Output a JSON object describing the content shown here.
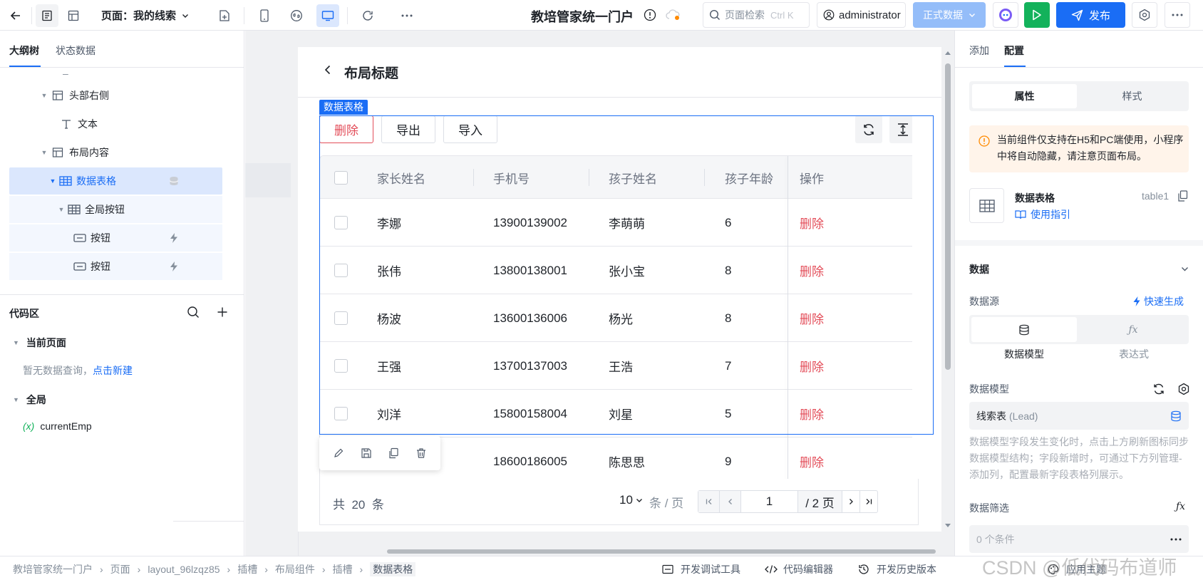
{
  "topbar": {
    "page_label": "页面：我的线索",
    "app_title": "教培管家统一门户",
    "search_placeholder": "页面检索",
    "search_shortcut": "Ctrl K",
    "user": "administrator",
    "env": "正式数据",
    "publish": "发布"
  },
  "left": {
    "tabs": [
      "大纲树",
      "状态数据"
    ],
    "tree": {
      "dash": "–",
      "header_right": "头部右侧",
      "text": "文本",
      "layout_content": "布局内容",
      "data_table": "数据表格",
      "global_buttons": "全局按钮",
      "button1": "按钮",
      "button2": "按钮"
    },
    "code": {
      "title": "代码区",
      "current_page": "当前页面",
      "empty_hint": "暂无数据查询，",
      "create_link": "点击新建",
      "global": "全局",
      "var_icon": "(x)",
      "var_name": "currentEmp"
    }
  },
  "canvas": {
    "page_title": "布局标题",
    "selected_tag": "数据表格",
    "buttons": [
      "删除",
      "导出",
      "导入"
    ],
    "columns": [
      "家长姓名",
      "手机号",
      "孩子姓名",
      "孩子年龄",
      "操作"
    ],
    "rows": [
      {
        "parent": "李娜",
        "phone": "13900139002",
        "child": "李萌萌",
        "age": "6",
        "action": "删除"
      },
      {
        "parent": "张伟",
        "phone": "13800138001",
        "child": "张小宝",
        "age": "8",
        "action": "删除"
      },
      {
        "parent": "杨波",
        "phone": "13600136006",
        "child": "杨光",
        "age": "8",
        "action": "删除"
      },
      {
        "parent": "王强",
        "phone": "13700137003",
        "child": "王浩",
        "age": "7",
        "action": "删除"
      },
      {
        "parent": "刘洋",
        "phone": "15800158004",
        "child": "刘星",
        "age": "5",
        "action": "删除"
      },
      {
        "parent": "",
        "phone": "18600186005",
        "child": "陈思思",
        "age": "9",
        "action": "删除"
      }
    ],
    "pagination": {
      "total_prefix": "共",
      "total": "20",
      "total_suffix": "条",
      "page_size": "10",
      "per_page": "条 / 页",
      "current": "1",
      "pages": "/ 2 页"
    }
  },
  "right": {
    "tabs": [
      "添加",
      "配置"
    ],
    "subtabs": [
      "属性",
      "样式"
    ],
    "warning": "当前组件仅支持在H5和PC端使用，小程序中将自动隐藏，请注意页面布局。",
    "component_name": "数据表格",
    "component_id": "table1",
    "guide_link": "使用指引",
    "section_data": "数据",
    "datasource_label": "数据源",
    "quick_gen": "快速生成",
    "ds_options": [
      "数据模型",
      "表达式"
    ],
    "model_label": "数据模型",
    "model_value": "线索表",
    "model_value_en": "(Lead)",
    "model_hint": "数据模型字段发生变化时，点击上方刷新图标同步数据模型结构；字段新增时，可通过下方列管理-添加列，配置最新字段表格列展示。",
    "filter_label": "数据筛选",
    "filter_value": "0 个条件"
  },
  "status": {
    "breadcrumb": [
      "教培管家统一门户",
      "页面",
      "layout_96lzqz85",
      "插槽",
      "布局组件",
      "插槽",
      "数据表格"
    ],
    "tools": [
      "开发调试工具",
      "代码编辑器",
      "开发历史版本",
      "应用主题"
    ],
    "watermark": "CSDN @低代码布道师"
  },
  "colors": {
    "primary": "#1a6df5",
    "danger": "#e34d59",
    "green": "#13b25b",
    "selected_bg": "#dbe7fd",
    "warn_bg": "#fff4ea",
    "warn_icon": "#ff8a00"
  }
}
